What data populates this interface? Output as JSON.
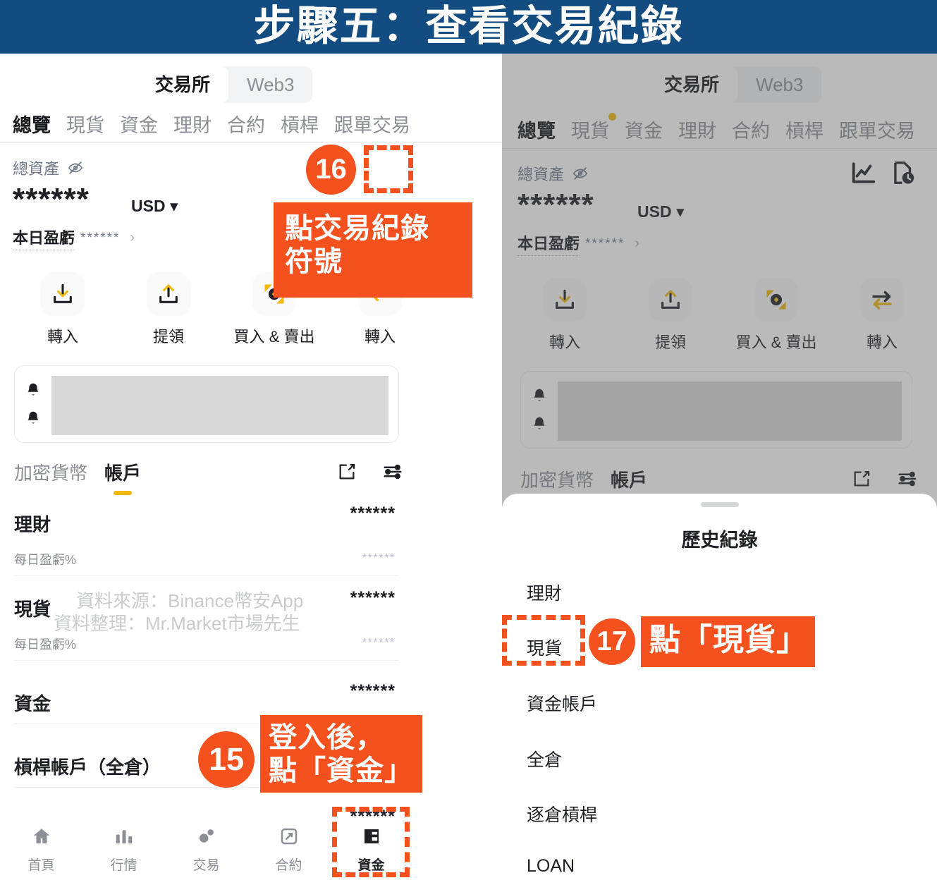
{
  "header": {
    "title": "步驟五：查看交易紀錄",
    "bg_color": "#124c80",
    "text_color": "#ffffff"
  },
  "theme": {
    "accent_orange": "#f4511e",
    "binance_yellow": "#f0b90b",
    "muted_text": "#8c8f96"
  },
  "left_phone": {
    "segmented": {
      "options": [
        "交易所",
        "Web3"
      ],
      "selected": "交易所"
    },
    "nav_tabs": [
      {
        "label": "總覽",
        "active": true
      },
      {
        "label": "現貨",
        "active": false
      },
      {
        "label": "資金",
        "active": false
      },
      {
        "label": "理財",
        "active": false
      },
      {
        "label": "合約",
        "active": false
      },
      {
        "label": "槓桿",
        "active": false
      },
      {
        "label": "跟單交易",
        "active": false
      }
    ],
    "total_assets": {
      "label": "總資產",
      "value": "******",
      "currency": "USD",
      "pnl_label": "本日盈虧",
      "pnl_value": "******",
      "chevron": "›"
    },
    "actions": [
      {
        "label": "轉入",
        "icon": "deposit-icon"
      },
      {
        "label": "提領",
        "icon": "withdraw-icon"
      },
      {
        "label": "買入 & 賣出",
        "icon": "buy-sell-icon"
      },
      {
        "label": "轉入",
        "icon": "arrow-left-icon"
      }
    ],
    "asset_tabs": {
      "options": [
        "加密貨幣",
        "帳戶"
      ],
      "selected": "帳戶"
    },
    "asset_tab_icons": [
      "edit-icon",
      "filter-icon"
    ],
    "asset_rows": [
      {
        "name": "理財",
        "value": "******",
        "sub": "每日盈虧%",
        "sub_value": "******"
      },
      {
        "name": "現貨",
        "value": "******",
        "sub": "每日盈虧%",
        "sub_value": "******"
      },
      {
        "name": "資金",
        "value": "******",
        "sub": "",
        "sub_value": ""
      },
      {
        "name": "槓桿帳戶（全倉）",
        "value": "******",
        "sub": "",
        "sub_value": ""
      }
    ],
    "bottom_nav": [
      {
        "label": "首頁",
        "icon": "home-icon",
        "active": false
      },
      {
        "label": "行情",
        "icon": "markets-icon",
        "active": false
      },
      {
        "label": "交易",
        "icon": "trade-icon",
        "active": false
      },
      {
        "label": "合約",
        "icon": "futures-icon",
        "active": false
      },
      {
        "label": "資金",
        "icon": "wallet-icon",
        "active": true
      }
    ],
    "watermark": [
      "資料來源：Binance幣安App",
      "資料整理：Mr.Market市場先生"
    ]
  },
  "right_phone": {
    "segmented": {
      "options": [
        "交易所",
        "Web3"
      ],
      "selected": "交易所"
    },
    "nav_tabs": [
      {
        "label": "總覽",
        "active": true,
        "badge": false
      },
      {
        "label": "現貨",
        "active": false,
        "badge": true
      },
      {
        "label": "資金",
        "active": false,
        "badge": false
      },
      {
        "label": "理財",
        "active": false,
        "badge": false
      },
      {
        "label": "合約",
        "active": false,
        "badge": false
      },
      {
        "label": "槓桿",
        "active": false,
        "badge": false
      },
      {
        "label": "跟單交易",
        "active": false,
        "badge": false
      }
    ],
    "total_assets": {
      "label": "總資產",
      "value": "******",
      "currency": "USD",
      "pnl_label": "本日盈虧",
      "pnl_value": "******",
      "chevron": "›"
    },
    "header_icons": [
      "chart-icon",
      "history-icon"
    ],
    "actions": [
      {
        "label": "轉入",
        "icon": "deposit-icon"
      },
      {
        "label": "提領",
        "icon": "withdraw-icon"
      },
      {
        "label": "買入 & 賣出",
        "icon": "buy-sell-icon"
      },
      {
        "label": "轉入",
        "icon": "transfer-icon"
      }
    ],
    "asset_tabs": {
      "options": [
        "加密貨幣",
        "帳戶"
      ],
      "selected": "帳戶"
    },
    "sheet": {
      "title": "歷史紀錄",
      "items": [
        "理財",
        "現貨",
        "資金帳戶",
        "全倉",
        "逐倉槓桿",
        "LOAN"
      ]
    }
  },
  "annotations": [
    {
      "id": "15",
      "text": "登入後，\n點「資金」"
    },
    {
      "id": "16",
      "text": "點交易紀錄\n符號"
    },
    {
      "id": "17",
      "text": "點「現貨」"
    }
  ]
}
